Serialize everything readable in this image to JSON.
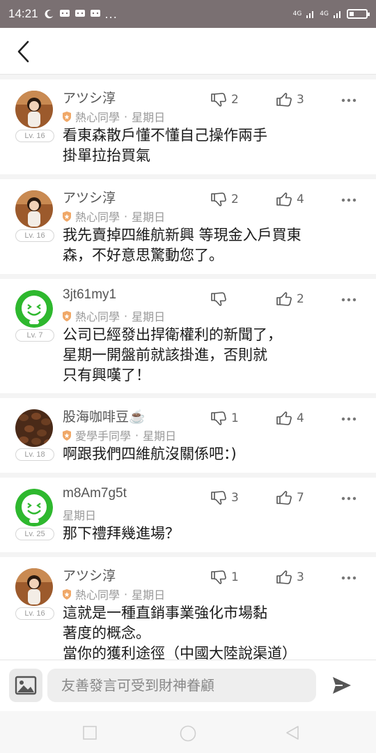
{
  "status_bar": {
    "time": "14:21",
    "network_labels": [
      "4G",
      "4G"
    ]
  },
  "header": {
    "back_icon": "chevron-left-icon"
  },
  "posts": [
    {
      "username": "アツシ淳",
      "badge": "熱心同學",
      "date": "星期日",
      "level": "Lv. 16",
      "avatar": "girl-photo",
      "content": "看東森散戶懂不懂自己操作兩手\n掛單拉抬買氣",
      "dislikes": "2",
      "likes": "3"
    },
    {
      "username": "アツシ淳",
      "badge": "熱心同學",
      "date": "星期日",
      "level": "Lv. 16",
      "avatar": "girl-photo",
      "content": "我先賣掉四維航新興 等現金入戶買東\n森，不好意思驚動您了。",
      "dislikes": "2",
      "likes": "4"
    },
    {
      "username": "3jt61my1",
      "badge": "熱心同學",
      "date": "星期日",
      "level": "Lv. 7",
      "avatar": "green-smiley",
      "content": "公司已經發出捍衛權利的新聞了，\n星期一開盤前就該掛進，否則就\n只有興嘆了！",
      "dislikes": "",
      "likes": "2"
    },
    {
      "username": "股海咖啡豆☕",
      "badge": "愛學手同學",
      "date": "星期日",
      "level": "Lv. 18",
      "avatar": "coffee-beans",
      "content": "啊跟我們四維航沒關係吧：)",
      "dislikes": "1",
      "likes": "4"
    },
    {
      "username": "m8Am7g5t",
      "badge": "",
      "date": "星期日",
      "level": "Lv. 25",
      "avatar": "green-smiley",
      "content": "那下禮拜幾進場？",
      "dislikes": "3",
      "likes": "7"
    },
    {
      "username": "アツシ淳",
      "badge": "熱心同學",
      "date": "星期日",
      "level": "Lv. 16",
      "avatar": "girl-photo",
      "content": "這就是一種直銷事業強化市場黏\n著度的概念。\n當你的獲利途徑（中國大陸說渠道）",
      "dislikes": "1",
      "likes": "3"
    }
  ],
  "composer": {
    "placeholder": "友善發言可受到財神眷顧",
    "image_icon": "image-icon",
    "send_icon": "send-icon"
  },
  "colors": {
    "status_bar": "#7a7072",
    "badge": "#f0a868",
    "green_avatar": "#2eb82e"
  }
}
